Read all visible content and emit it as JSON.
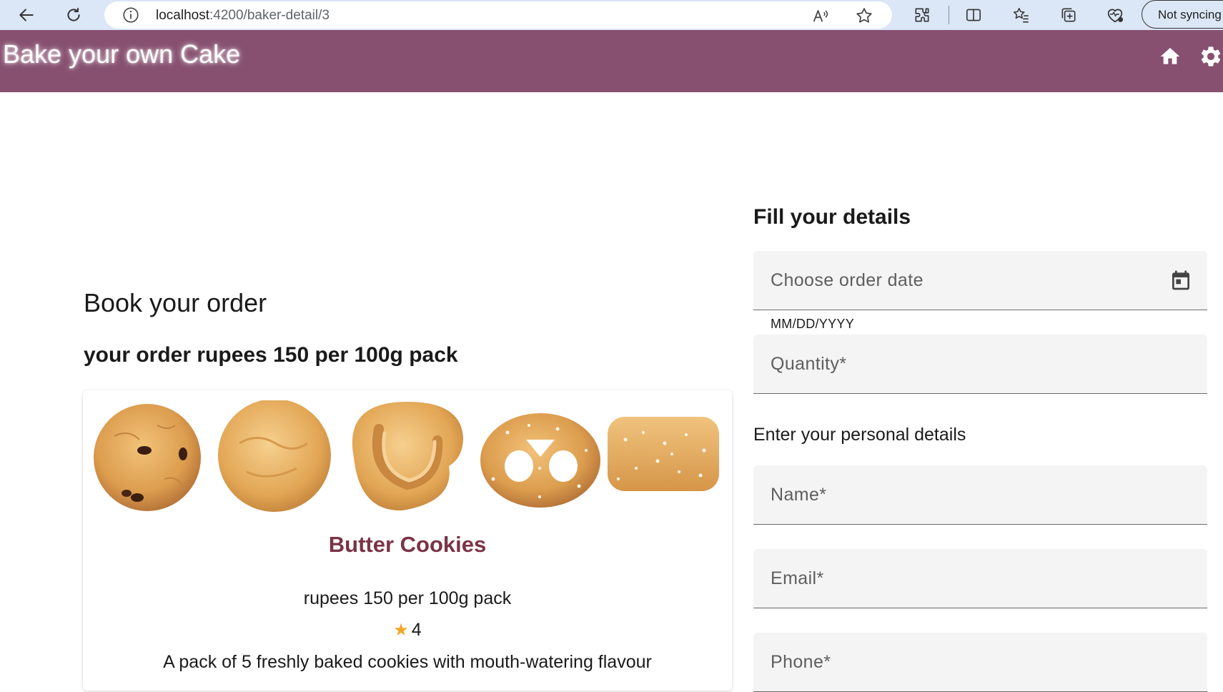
{
  "browser": {
    "url_host": "localhost",
    "url_path": ":4200/baker-detail/3",
    "sync_label": "Not syncing",
    "icons": [
      "back-arrow-icon",
      "refresh-icon",
      "info-icon",
      "read-aloud-icon",
      "favorite-star-icon",
      "extensions-icon",
      "split-screen-icon",
      "favorites-icon",
      "collections-icon",
      "browser-essentials-icon"
    ]
  },
  "app": {
    "title": "Bake your own Cake",
    "toolbar_color": "#875070",
    "icons": [
      "home-icon",
      "settings-gear-icon"
    ]
  },
  "order": {
    "heading": "Book your order",
    "price_heading": "your order rupees 150 per 100g pack"
  },
  "product": {
    "name": "Butter Cookies",
    "price": "rupees 150 per 100g pack",
    "rating": "4",
    "description": "A pack of 5 freshly baked cookies with mouth-watering flavour",
    "image_items": [
      "round cookie with raisins",
      "round butter cookie",
      "swirl cookie",
      "pretzel cookie",
      "sugar-topped square cookie"
    ]
  },
  "form": {
    "heading": "Fill your details",
    "date_placeholder": "Choose order date",
    "date_hint": "MM/DD/YYYY",
    "quantity_placeholder": "Quantity*",
    "personal_heading": "Enter your personal details",
    "name_placeholder": "Name*",
    "email_placeholder": "Email*",
    "phone_placeholder": "Phone*"
  }
}
